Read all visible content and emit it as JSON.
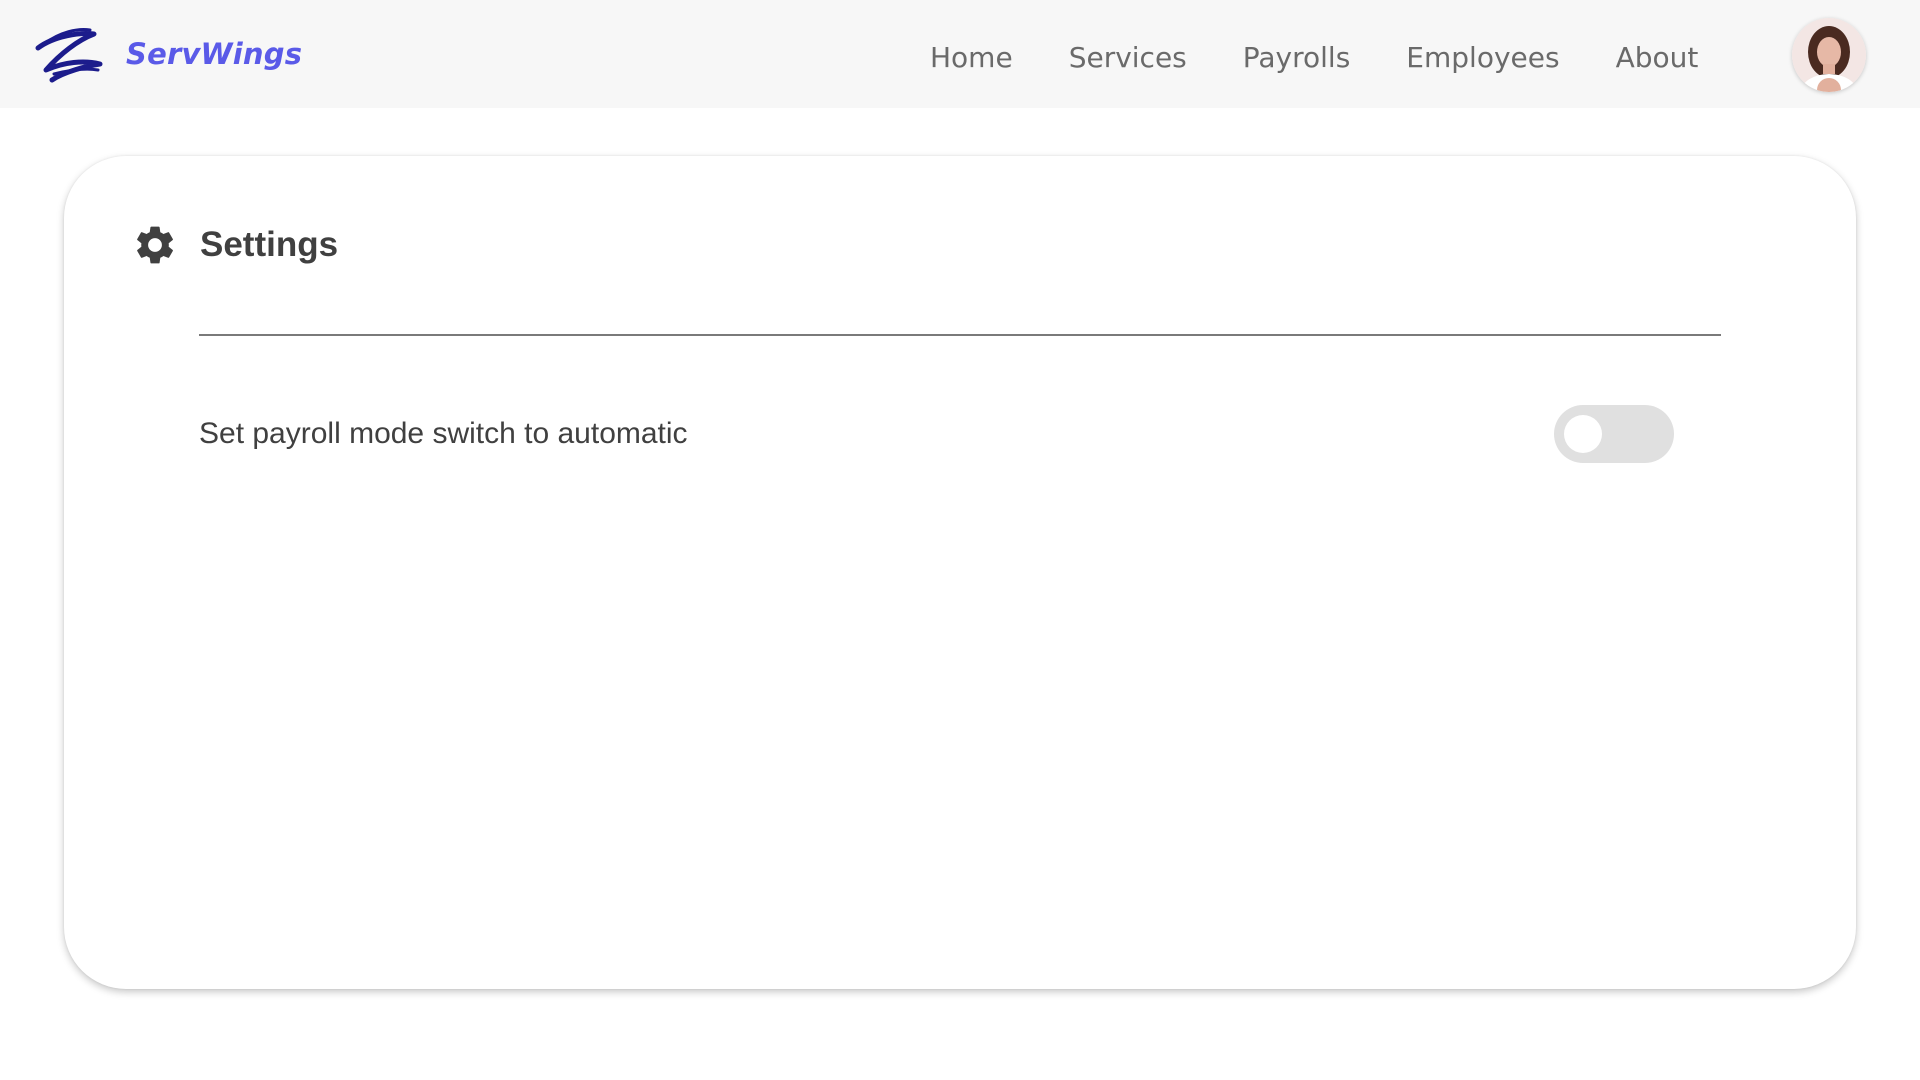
{
  "header": {
    "brand_name": "ServWings",
    "logo_icon": "servwings-logo-icon",
    "nav": [
      {
        "label": "Home"
      },
      {
        "label": "Services"
      },
      {
        "label": "Payrolls"
      },
      {
        "label": "Employees"
      },
      {
        "label": "About"
      }
    ],
    "avatar_icon": "user-avatar"
  },
  "settings": {
    "title": "Settings",
    "title_icon": "gear-icon",
    "options": [
      {
        "label": "Set payroll mode switch to automatic",
        "enabled": false
      }
    ]
  },
  "colors": {
    "brand": "#5a5ae8",
    "logo": "#1c1c8c",
    "toggle_off": "#e0e0e0",
    "text": "#404040"
  }
}
